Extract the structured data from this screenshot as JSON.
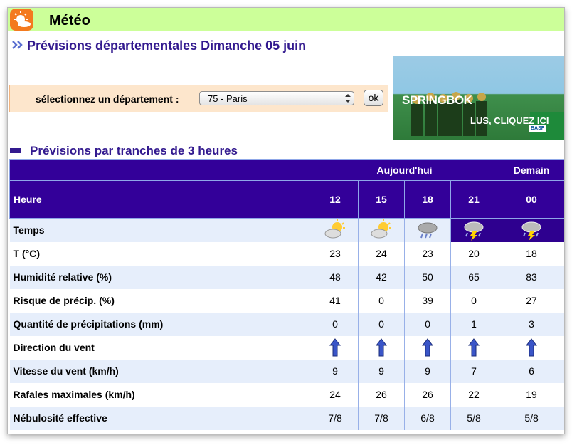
{
  "header": {
    "title": "Météo",
    "logo_icon": "sun-cloud-icon"
  },
  "subtitle": "Prévisions départementales Dimanche 05 juin",
  "department": {
    "label": "sélectionnez un département :",
    "selected": "75 - Paris",
    "ok_label": "ok"
  },
  "ad": {
    "brand": "SPRINGBOK",
    "cta": "LUS, CLIQUEZ ICI",
    "sponsor": "BASF"
  },
  "section_title": "Prévisions par tranches de 3 heures",
  "table": {
    "day_today": "Aujourd'hui",
    "day_tomorrow": "Demain",
    "hour_label": "Heure",
    "hours": [
      "12",
      "15",
      "18",
      "21",
      "00"
    ],
    "rows": [
      {
        "label": "Temps",
        "values": [
          "partly-sunny",
          "partly-sunny",
          "rain-cloud",
          "storm-cloud",
          "storm-cloud"
        ]
      },
      {
        "label": "T (°C)",
        "values": [
          "23",
          "24",
          "23",
          "20",
          "18"
        ]
      },
      {
        "label": "Humidité relative (%)",
        "values": [
          "48",
          "42",
          "50",
          "65",
          "83"
        ]
      },
      {
        "label": "Risque de précip. (%)",
        "values": [
          "41",
          "0",
          "39",
          "0",
          "27"
        ]
      },
      {
        "label": "Quantité de précipitations (mm)",
        "values": [
          "0",
          "0",
          "0",
          "1",
          "3"
        ]
      },
      {
        "label": "Direction du vent",
        "values": [
          "north-arrow",
          "north-arrow",
          "north-arrow",
          "north-arrow",
          "north-arrow"
        ]
      },
      {
        "label": "Vitesse du vent (km/h)",
        "values": [
          "9",
          "9",
          "9",
          "7",
          "6"
        ]
      },
      {
        "label": "Rafales maximales (km/h)",
        "values": [
          "24",
          "26",
          "26",
          "22",
          "19"
        ]
      },
      {
        "label": "Nébulosité effective",
        "values": [
          "7/8",
          "7/8",
          "6/8",
          "5/8",
          "5/8"
        ]
      }
    ]
  },
  "colors": {
    "header_bg": "#ccff99",
    "title_color": "#331a8f",
    "table_header": "#330099",
    "row_alt": "#e6eefb",
    "select_bg": "#fde6cc"
  }
}
